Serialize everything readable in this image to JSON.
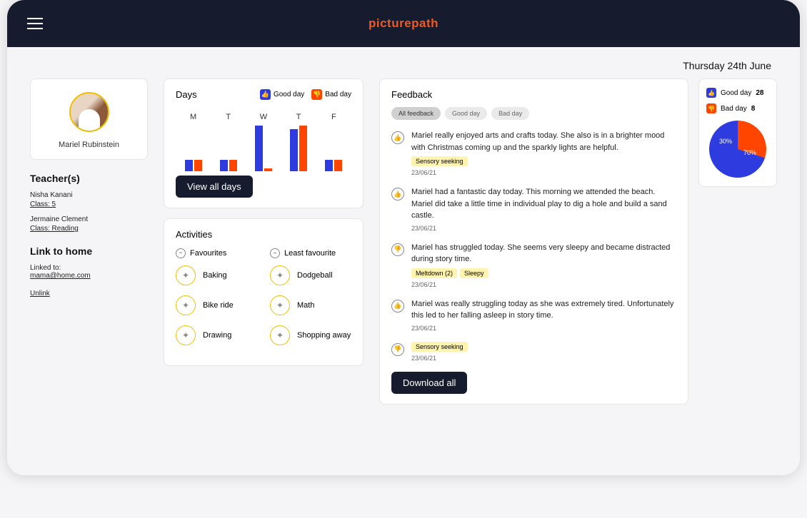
{
  "brand": "picturepath",
  "date": "Thursday 24th June",
  "profile": {
    "name": "Mariel Rubinstein"
  },
  "teachers_heading": "Teacher(s)",
  "teachers": [
    {
      "name": "Nisha Kanani",
      "class": "Class: 5"
    },
    {
      "name": "Jermaine Clement",
      "class": "Class: Reading"
    }
  ],
  "link_home": {
    "heading": "Link to home",
    "linked_label": "Linked to:",
    "email": "mama@home.com",
    "unlink": "Unlink"
  },
  "days": {
    "title": "Days",
    "legend_good": "Good day",
    "legend_bad": "Bad day",
    "view_all": "View all days"
  },
  "chart_data": {
    "type": "bar",
    "title": "Days",
    "categories": [
      "M",
      "T",
      "W",
      "T",
      "F"
    ],
    "series": [
      {
        "name": "Good day",
        "color": "#2e3bdf",
        "values": [
          15,
          15,
          60,
          55,
          15
        ]
      },
      {
        "name": "Bad day",
        "color": "#ff4500",
        "values": [
          15,
          15,
          4,
          60,
          15
        ]
      }
    ],
    "ylim": [
      0,
      60
    ]
  },
  "activities": {
    "title": "Activities",
    "fav_label": "Favourites",
    "leastfav_label": "Least favourite",
    "favourites": [
      "Baking",
      "Bike ride",
      "Drawing"
    ],
    "least": [
      "Dodgeball",
      "Math",
      "Shopping away"
    ]
  },
  "feedback": {
    "title": "Feedback",
    "filters": [
      "All feedback",
      "Good day",
      "Bad day"
    ],
    "download": "Download all",
    "items": [
      {
        "mood": "up",
        "text": "Mariel really enjoyed arts and crafts today. She also is in a brighter mood with Christmas coming up and the sparkly lights are helpful.",
        "tags": [
          "Sensory seeking"
        ],
        "date": "23/06/21"
      },
      {
        "mood": "up",
        "text": "Mariel had a fantastic day today. This morning we attended the beach. Mariel did take a little time in individual play to dig a hole and build a sand castle.",
        "tags": [],
        "date": "23/06/21"
      },
      {
        "mood": "down",
        "text": "Mariel has struggled today. She seems very sleepy and became distracted during story time.",
        "tags": [
          "Meltdown (2)",
          "Sleepy"
        ],
        "date": "23/06/21"
      },
      {
        "mood": "up",
        "text": "Mariel was really struggling today as she was extremely tired. Unfortunately this led to her falling asleep in story time.",
        "tags": [],
        "date": "23/06/21"
      },
      {
        "mood": "down",
        "text": "",
        "tags": [
          "Sensory seeking"
        ],
        "date": "23/06/21"
      }
    ]
  },
  "stats": {
    "good_label": "Good day",
    "good_count": "28",
    "bad_label": "Bad day",
    "bad_count": "8",
    "pie_good": "70%",
    "pie_bad": "30%"
  }
}
